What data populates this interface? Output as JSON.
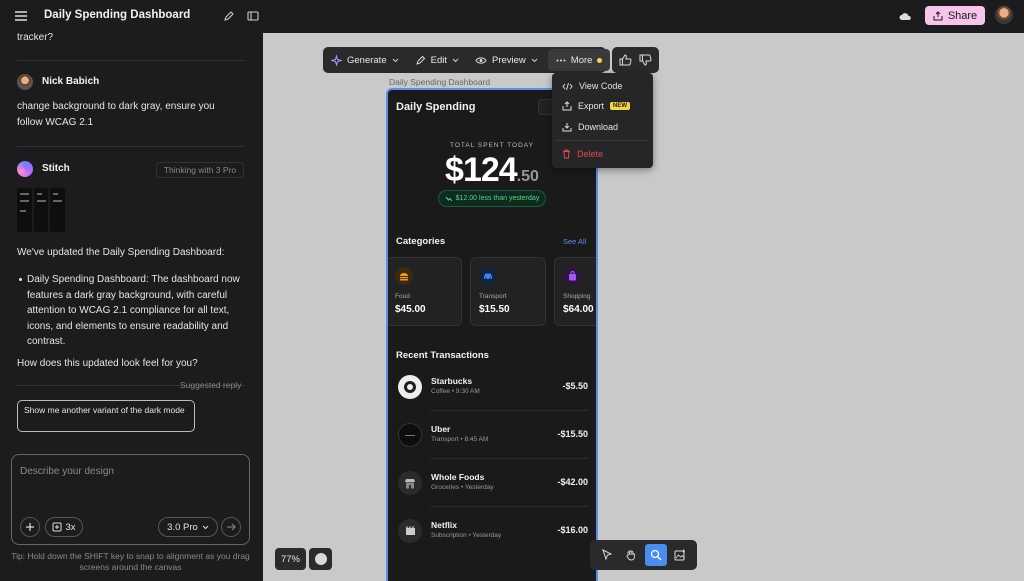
{
  "header": {
    "project_title": "Daily Spending Dashboard",
    "share_label": "Share"
  },
  "chat": {
    "prev_tail": "tracker?",
    "user_name": "Nick Babich",
    "user_message_line1": "change background to dark gray, ensure you",
    "user_message_line2": "follow WCAG 2.1",
    "assistant_name": "Stitch",
    "thinking_label": "Thinking with 3 Pro",
    "reply_intro": "We've updated the Daily Spending Dashboard:",
    "reply_bullet": [
      "Daily Spending Dashboard: The dashboard now",
      "features a dark gray background, with careful",
      "attention to WCAG 2.1 compliance for all text,",
      "icons, and elements to ensure readability and",
      "contrast."
    ],
    "reply_question": "How does this updated look feel for you?",
    "suggested_label": "Suggested reply",
    "suggested_reply": "Show me another variant of the dark mode"
  },
  "composer": {
    "placeholder": "Describe your design",
    "multiplier": "3x",
    "model": "3.0 Pro",
    "tip": "Tip: Hold down the SHIFT key to snap to alignment as you drag screens around the canvas"
  },
  "toolbar": {
    "generate": "Generate",
    "edit": "Edit",
    "preview": "Preview",
    "more": "More"
  },
  "more_menu": {
    "view_code": "View Code",
    "export": "Export",
    "new_badge": "NEW",
    "download": "Download",
    "delete": "Delete"
  },
  "canvas": {
    "frame_label": "Daily Spending Dashboard",
    "zoom": "77%"
  },
  "screen": {
    "title": "Daily Spending",
    "total_label": "TOTAL SPENT TODAY",
    "total_main": "$124",
    "total_cents": ".50",
    "diff": "$12.00 less than yesterday",
    "categories_title": "Categories",
    "see_all": "See All",
    "categories": [
      {
        "name": "Food",
        "amount": "$45.00",
        "icon": "burger-icon",
        "color": "#f59e0b"
      },
      {
        "name": "Transport",
        "amount": "$15.50",
        "icon": "car-icon",
        "color": "#3b82f6"
      },
      {
        "name": "Shopping",
        "amount": "$64.00",
        "icon": "bag-icon",
        "color": "#a855f7"
      }
    ],
    "transactions_title": "Recent Transactions",
    "transactions": [
      {
        "name": "Starbucks",
        "sub": "Coffee • 9:30 AM",
        "amount": "-$5.50",
        "icon": "starbucks-logo-icon"
      },
      {
        "name": "Uber",
        "sub": "Transport • 8:45 AM",
        "amount": "-$15.50",
        "icon": "uber-logo-icon"
      },
      {
        "name": "Whole Foods",
        "sub": "Groceries • Yesterday",
        "amount": "-$42.00",
        "icon": "store-icon"
      },
      {
        "name": "Netflix",
        "sub": "Subscription • Yesterday",
        "amount": "-$16.00",
        "icon": "film-icon"
      }
    ]
  },
  "colors": {
    "accent": "#4a8cf0",
    "share_bg": "#f9c4ea",
    "delete": "#e5484d",
    "positive": "#4ade80"
  }
}
